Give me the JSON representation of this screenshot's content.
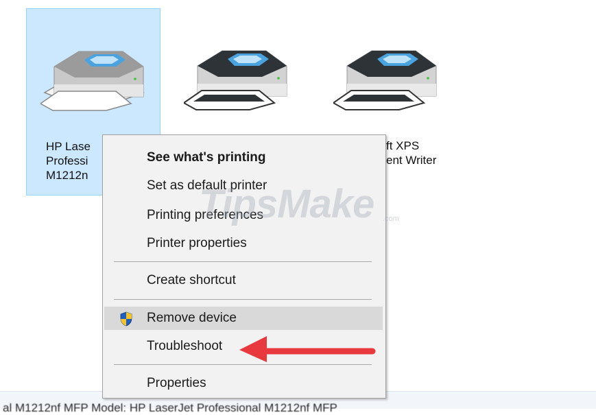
{
  "devices": [
    {
      "label": "HP Lase\nProfessi\nM1212n",
      "selected": true
    },
    {
      "label": "",
      "selected": false
    },
    {
      "label": "ft XPS\nent Writer",
      "selected": false
    }
  ],
  "context_menu": {
    "items": [
      {
        "label": "See what's printing",
        "bold": true
      },
      {
        "label": "Set as default printer"
      },
      {
        "label": "Printing preferences"
      },
      {
        "label": "Printer properties"
      },
      {
        "label": "Create shortcut"
      },
      {
        "label": "Remove device",
        "icon": "uac-shield-icon",
        "highlighted": true
      },
      {
        "label": "Troubleshoot"
      },
      {
        "label": "Properties"
      }
    ]
  },
  "status_bar": {
    "text": "al M1212nf MFP    Model: HP LaserJet Professional M1212nf MFP"
  },
  "watermark": {
    "text": "TipsMake",
    "suffix": ".com"
  },
  "colors": {
    "selection_fill": "#cce8ff",
    "selection_border": "#99d1ff",
    "menu_background": "#f2f2f2",
    "menu_hover": "#d9d9d9",
    "annotation_arrow": "#e8393f"
  }
}
